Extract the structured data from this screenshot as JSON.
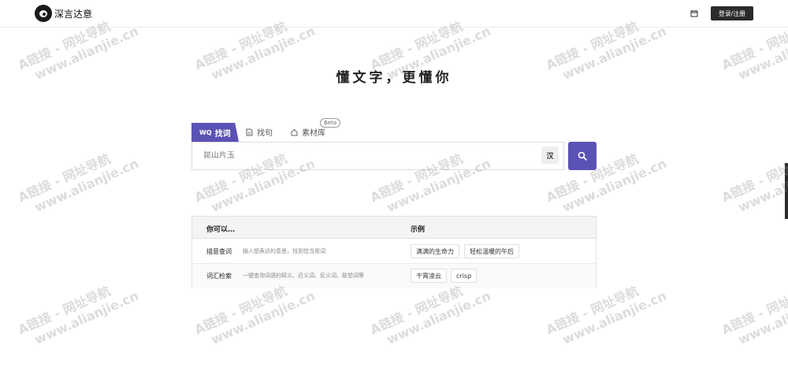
{
  "header": {
    "logo_text": "深言达意",
    "login_label": "登录/注册"
  },
  "hero": {
    "slogan": "懂文字，更懂你"
  },
  "tabs": [
    {
      "label": "找词",
      "prefix": "WQ"
    },
    {
      "label": "找句"
    },
    {
      "label": "素材库",
      "badge": "Beta"
    }
  ],
  "search": {
    "placeholder": "昆山片玉",
    "han_label": "汉"
  },
  "table": {
    "col_capability": "你可以…",
    "col_example": "示例",
    "rows": [
      {
        "name": "描意查词",
        "desc": "输入想表达的意思，找到恰当用词",
        "examples": [
          "满满的生命力",
          "轻松温暖的午后"
        ]
      },
      {
        "name": "词汇检索",
        "desc": "一键查询词语的释义、近义词、反义词、联想词等",
        "examples": [
          "干霄凌云",
          "crisp"
        ]
      }
    ]
  },
  "watermark": {
    "line1": "A链接 - 网址导航",
    "line2": "www.alianjie.cn"
  },
  "colors": {
    "accent": "#5b52b5",
    "dark": "#2b2b2b"
  }
}
